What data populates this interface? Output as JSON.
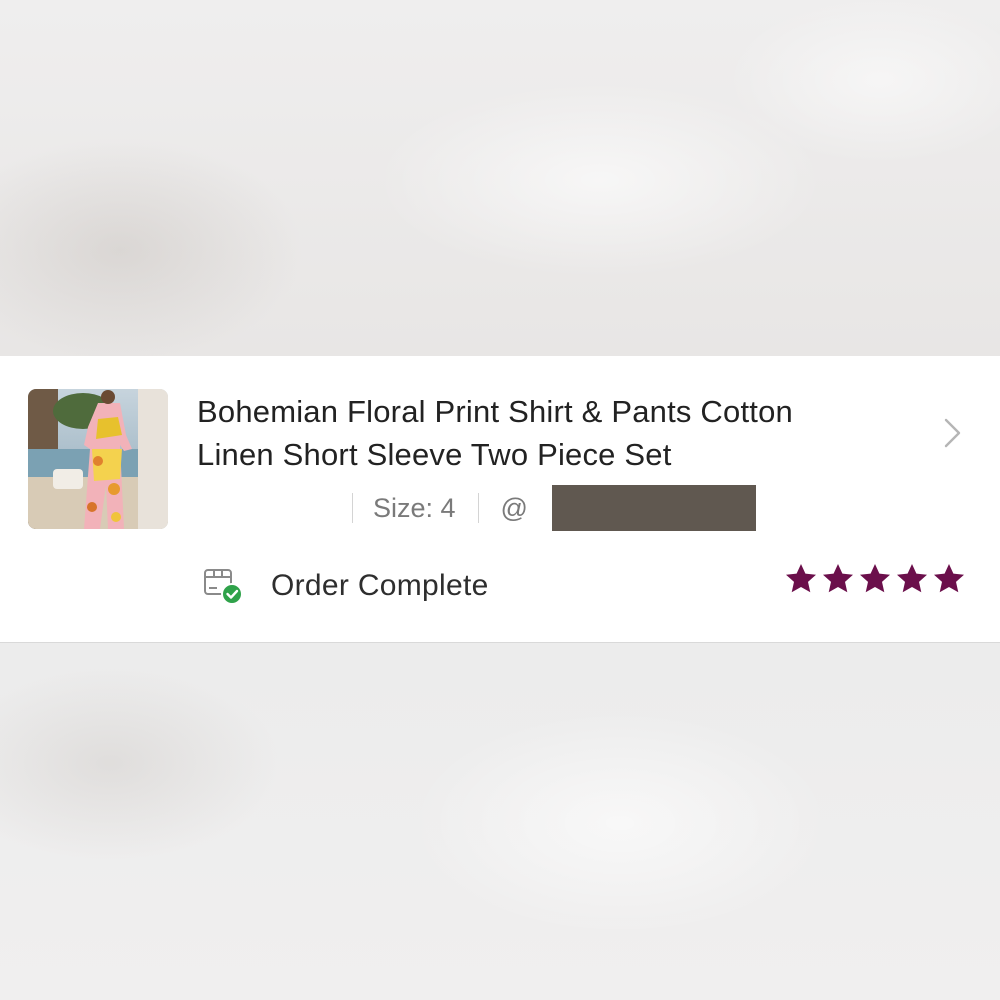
{
  "order": {
    "title_line1": "Bohemian Floral Print Shirt & Pants Cotton",
    "title_line2": "Linen Short Sleeve Two Piece Set",
    "size_text": "Size: 4",
    "handle_prefix": "@",
    "status": "Order Complete",
    "rating": 5,
    "rating_max": 5
  },
  "icons": {
    "thumbnail": "product-photo",
    "chevron": "chevron-right-icon",
    "status": "package-check-icon",
    "star": "star-icon"
  },
  "colors": {
    "star": "#6b0f4b",
    "check": "#2fa24a",
    "title": "#222222",
    "meta": "#7a7a7a"
  }
}
